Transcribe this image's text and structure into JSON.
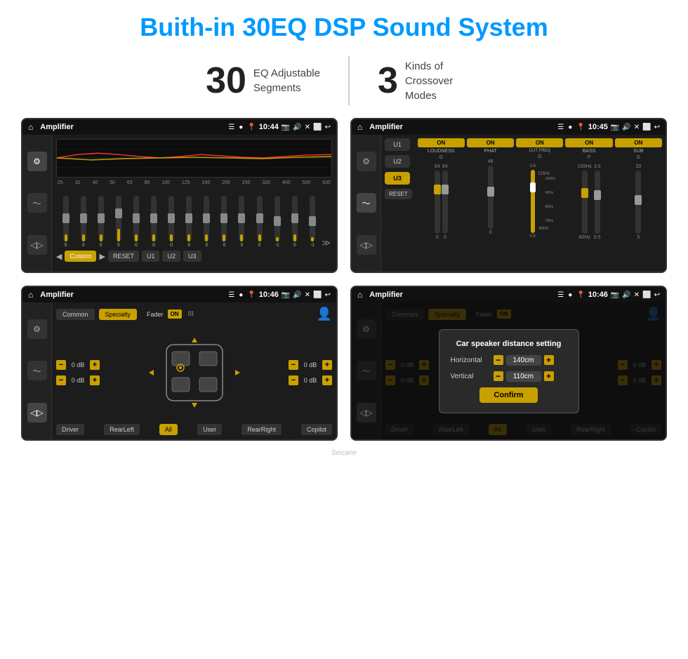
{
  "page": {
    "title": "Buith-in 30EQ DSP Sound System",
    "stats": [
      {
        "number": "30",
        "label": "EQ Adjustable\nSegments"
      },
      {
        "number": "3",
        "label": "Kinds of\nCrossover Modes"
      }
    ]
  },
  "screens": {
    "eq1": {
      "title": "Amplifier",
      "time": "10:44",
      "freq_labels": [
        "25",
        "32",
        "40",
        "50",
        "63",
        "80",
        "100",
        "125",
        "160",
        "200",
        "250",
        "320",
        "400",
        "500",
        "630"
      ],
      "sliders": [
        0,
        0,
        0,
        5,
        0,
        0,
        0,
        0,
        0,
        0,
        0,
        0,
        -1,
        0,
        -1
      ],
      "presets": [
        "Custom",
        "RESET",
        "U1",
        "U2",
        "U3"
      ]
    },
    "eq2": {
      "title": "Amplifier",
      "time": "10:45",
      "presets": [
        "U1",
        "U2",
        "U3"
      ],
      "channels": [
        "LOUDNESS",
        "PHAT",
        "CUT FREQ",
        "BASS",
        "SUB"
      ],
      "channel_states": [
        "ON",
        "ON",
        "ON",
        "ON",
        "ON"
      ],
      "labels": [
        "G",
        "",
        "G",
        "F",
        "G",
        "F",
        "G"
      ]
    },
    "specialty1": {
      "title": "Amplifier",
      "time": "10:46",
      "btns": [
        "Common",
        "Specialty"
      ],
      "fader_label": "Fader",
      "fader_state": "ON",
      "controls": {
        "top_left_db": "0 dB",
        "bot_left_db": "0 dB",
        "top_right_db": "0 dB",
        "bot_right_db": "0 dB"
      },
      "bottom_btns": [
        "Driver",
        "RearLeft",
        "All",
        "User",
        "RearRight",
        "Copilot"
      ]
    },
    "specialty2": {
      "title": "Amplifier",
      "time": "10:46",
      "btns": [
        "Common",
        "Specialty"
      ],
      "dialog": {
        "title": "Car speaker distance setting",
        "horizontal_label": "Horizontal",
        "horizontal_val": "140cm",
        "vertical_label": "Vertical",
        "vertical_val": "110cm",
        "confirm_btn": "Confirm"
      },
      "controls": {
        "top_right_db": "0 dB",
        "bot_right_db": "0 dB"
      },
      "bottom_btns": [
        "Driver",
        "RearLeft",
        "All",
        "User",
        "RearRight",
        "Copilot"
      ]
    }
  },
  "watermark": "Seicane"
}
